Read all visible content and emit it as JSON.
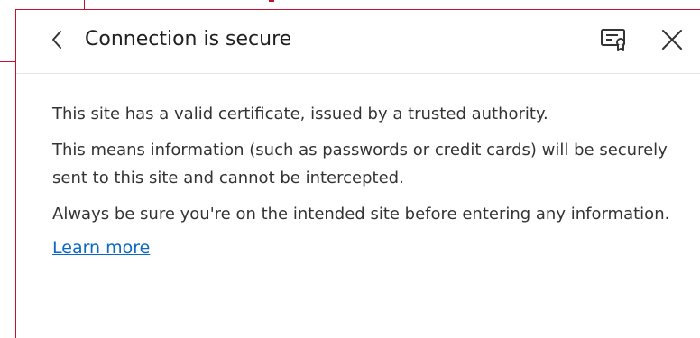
{
  "flyout": {
    "title": "Connection is secure",
    "back_icon": "chevron-left-icon",
    "certificate_icon": "certificate-icon",
    "close_icon": "close-icon"
  },
  "content": {
    "paragraphs": [
      "This site has a valid certificate, issued by a trusted authority.",
      "This means information (such as passwords or credit cards) will be securely sent to this site and cannot be intercepted.",
      "Always be sure you're on the intended site before entering any information."
    ],
    "learn_more": "Learn more"
  },
  "colors": {
    "link": "#0b68c4",
    "text": "#333333",
    "title": "#202020",
    "highlight": "#c8102e"
  }
}
